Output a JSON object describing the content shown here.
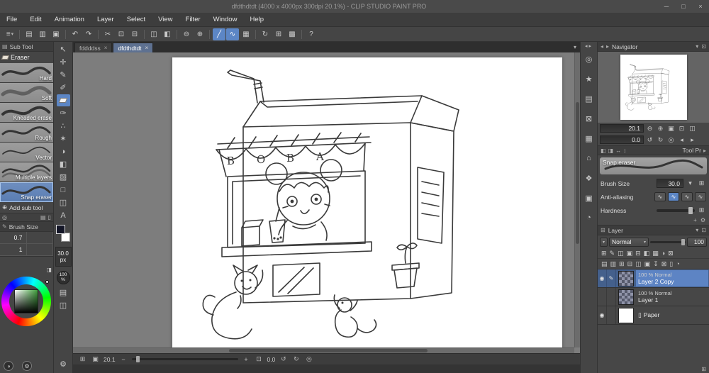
{
  "window": {
    "title": "dfdthdtdt (4000 x 4000px 300dpi 20.1%) - CLIP STUDIO PAINT PRO",
    "minimize_glyph": "─",
    "maximize_glyph": "□",
    "close_glyph": "×"
  },
  "menu": {
    "items": [
      "File",
      "Edit",
      "Animation",
      "Layer",
      "Select",
      "View",
      "Filter",
      "Window",
      "Help"
    ]
  },
  "toolbar": {
    "menu_glyph": "≡",
    "caret_glyph": "▾",
    "items": [
      {
        "name": "new-file",
        "glyph": "▤"
      },
      {
        "name": "open-file",
        "glyph": "▥"
      },
      {
        "name": "save-file",
        "glyph": "▣"
      },
      {
        "name": "undo",
        "glyph": "↶"
      },
      {
        "name": "redo",
        "glyph": "↷"
      },
      {
        "name": "cut",
        "glyph": "✂"
      },
      {
        "name": "copy",
        "glyph": "⊡"
      },
      {
        "name": "paste",
        "glyph": "⊟"
      },
      {
        "name": "erase",
        "glyph": "◫"
      },
      {
        "name": "fill",
        "glyph": "◧"
      },
      {
        "name": "zoom-out",
        "glyph": "⊖"
      },
      {
        "name": "zoom-in",
        "glyph": "⊕"
      },
      {
        "name": "snap-ruler",
        "glyph": "╱"
      },
      {
        "name": "snap-special-ruler",
        "glyph": "∿"
      },
      {
        "name": "snap-grid",
        "glyph": "▦"
      },
      {
        "name": "rotate-reset",
        "glyph": "↻"
      },
      {
        "name": "grid-toggle",
        "glyph": "⊞"
      },
      {
        "name": "material",
        "glyph": "▩"
      },
      {
        "name": "help",
        "glyph": "?"
      }
    ]
  },
  "tabs": {
    "documents": [
      {
        "label": "fddddss",
        "close_glyph": "×"
      },
      {
        "label": "dfdthdtdt",
        "close_glyph": "×"
      }
    ],
    "caret_glyph": "▾"
  },
  "subtool": {
    "panel_title": "Sub Tool",
    "group_title": "Eraser",
    "items": [
      "Hard",
      "Soft",
      "Kneaded erase",
      "Rough",
      "Vector",
      "Multiple layers",
      "Snap eraser"
    ],
    "add_label": "Add sub tool"
  },
  "brush_size_palette": {
    "title": "Brush Size",
    "presets": [
      "0.7",
      "1"
    ]
  },
  "toolstrip": {
    "tools": [
      {
        "name": "operation-tool",
        "glyph": "↖"
      },
      {
        "name": "move-tool",
        "glyph": "✛"
      },
      {
        "name": "pen-tool",
        "glyph": "✎"
      },
      {
        "name": "pencil-tool",
        "glyph": "✐"
      },
      {
        "name": "eraser-tool",
        "glyph": ""
      },
      {
        "name": "brush-tool",
        "glyph": "✑"
      },
      {
        "name": "airbrush-tool",
        "glyph": "∴"
      },
      {
        "name": "decoration-tool",
        "glyph": "✶"
      },
      {
        "name": "blend-tool",
        "glyph": "◑"
      },
      {
        "name": "fill-tool",
        "glyph": "◧"
      },
      {
        "name": "gradient-tool",
        "glyph": "▨"
      },
      {
        "name": "figure-tool",
        "glyph": "□"
      },
      {
        "name": "frame-tool",
        "glyph": "◫"
      },
      {
        "name": "text-tool",
        "glyph": "A"
      }
    ],
    "brush_size": "30.0",
    "brush_size_unit": "px",
    "opacity": "100",
    "opacity_unit": "%"
  },
  "statusbar": {
    "zoom": "20.1",
    "rotation": "0.0"
  },
  "navigator": {
    "title": "Navigator",
    "zoom": "20.1",
    "rotation": "0.0"
  },
  "tool_property": {
    "tab_label": "Tool Pr",
    "tool_name": "Snap eraser",
    "brush_size_label": "Brush Size",
    "brush_size_value": "30.0",
    "anti_aliasing_label": "Anti-aliasing",
    "hardness_label": "Hardness"
  },
  "layer_panel": {
    "title": "Layer",
    "blend_label": "Normal",
    "opacity_value": "100",
    "layers": [
      {
        "meta": "100 % Normal",
        "name": "Layer 2 Copy"
      },
      {
        "meta": "100 % Normal",
        "name": "Layer 1"
      },
      {
        "meta": "",
        "name": "Paper"
      }
    ]
  },
  "layer_tools": {
    "row1": [
      "⊞",
      "✎",
      "◫",
      "▣",
      "⊟",
      "◧",
      "▦",
      "◑",
      "⊠"
    ],
    "row2": [
      "▤",
      "▥",
      "⊞",
      "⊟",
      "◫",
      "▣",
      "↧",
      "⊠",
      "▯",
      "◔"
    ]
  },
  "rightstrip": {
    "icons": [
      {
        "name": "quick-access-icon",
        "glyph": "◎"
      },
      {
        "name": "material-star-icon",
        "glyph": "★"
      },
      {
        "name": "material-library-icon",
        "glyph": "▤"
      },
      {
        "name": "close-panel-icon",
        "glyph": "⊠"
      },
      {
        "name": "pattern-panel-icon",
        "glyph": "▦"
      },
      {
        "name": "home-panel-icon",
        "glyph": "⌂"
      },
      {
        "name": "decoration-panel-icon",
        "glyph": "❖"
      },
      {
        "name": "info-panel-icon",
        "glyph": "▣"
      },
      {
        "name": "history-panel-icon",
        "glyph": "◔"
      }
    ]
  },
  "glyphs": {
    "caret_down": "▾",
    "caret_left": "◂",
    "caret_right": "▸",
    "minus": "−",
    "plus": "+",
    "zoom_in": "⊕",
    "zoom_out": "⊖",
    "undo": "↺",
    "redo": "↻",
    "target": "◎",
    "box": "⊡",
    "grid": "⊞",
    "fit": "▣",
    "eye": "◉",
    "pen": "✎",
    "gear": "⚙",
    "half": "◑",
    "search": "◎",
    "flip_h": "◧",
    "flip_v": "◨",
    "arrow_h": "↔",
    "arrow_v": "↕",
    "page": "▯",
    "book": "▤",
    "frame": "◫",
    "wave": "∿"
  },
  "artwork": {
    "sign_letters": [
      "B",
      "O",
      "B",
      "A"
    ]
  }
}
